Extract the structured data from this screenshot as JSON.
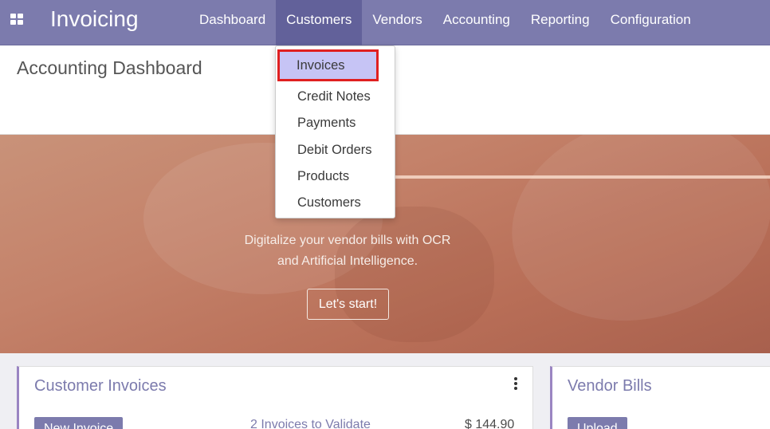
{
  "app": {
    "name": "Invoicing"
  },
  "navbar": {
    "menu": [
      {
        "label": "Dashboard"
      },
      {
        "label": "Customers"
      },
      {
        "label": "Vendors"
      },
      {
        "label": "Accounting"
      },
      {
        "label": "Reporting"
      },
      {
        "label": "Configuration"
      }
    ],
    "open_menu": "Customers"
  },
  "customers_dropdown": {
    "items": [
      {
        "label": "Invoices",
        "highlighted": true
      },
      {
        "label": "Credit Notes"
      },
      {
        "label": "Payments"
      },
      {
        "label": "Debit Orders"
      },
      {
        "label": "Products"
      },
      {
        "label": "Customers"
      }
    ]
  },
  "page": {
    "title": "Accounting Dashboard"
  },
  "banner": {
    "text_line1": "Digitalize your vendor bills with OCR",
    "text_line2": "and Artificial Intelligence.",
    "button_label": "Let's start!"
  },
  "cards": {
    "customer_invoices": {
      "title": "Customer Invoices",
      "new_button": "New Invoice",
      "validate_link": "2 Invoices to Validate",
      "amount": "$ 144.90"
    },
    "vendor_bills": {
      "title": "Vendor Bills",
      "upload_button": "Upload"
    }
  },
  "colors": {
    "navbar": "#7c7bad",
    "highlight_fill": "#c6c4f5",
    "highlight_border": "#e02020",
    "banner": "#c4826a"
  }
}
